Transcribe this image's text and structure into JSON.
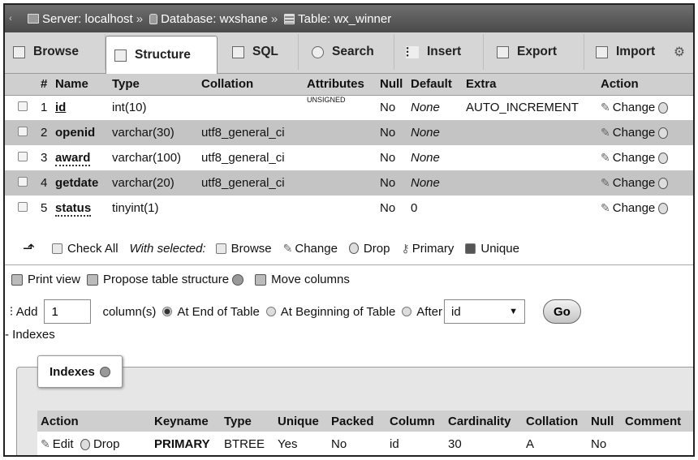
{
  "breadcrumb": {
    "server_label": "Server: localhost",
    "database_label": "Database: wxshane",
    "table_label": "Table: wx_winner",
    "separator": "»"
  },
  "tabs": [
    {
      "label": "Browse",
      "icon": "browse-icon"
    },
    {
      "label": "Structure",
      "icon": "structure-icon",
      "active": true
    },
    {
      "label": "SQL",
      "icon": "sql-icon"
    },
    {
      "label": "Search",
      "icon": "search-icon"
    },
    {
      "label": "Insert",
      "icon": "insert-icon"
    },
    {
      "label": "Export",
      "icon": "export-icon"
    },
    {
      "label": "Import",
      "icon": "import-icon"
    }
  ],
  "structure": {
    "headers": [
      "#",
      "Name",
      "Type",
      "Collation",
      "Attributes",
      "Null",
      "Default",
      "Extra",
      "Action"
    ],
    "rows": [
      {
        "num": "1",
        "name": "id",
        "type": "int(10)",
        "collation": "",
        "attributes": "UNSIGNED",
        "null": "No",
        "default": "None",
        "extra": "AUTO_INCREMENT",
        "action": "Change"
      },
      {
        "num": "2",
        "name": "openid",
        "type": "varchar(30)",
        "collation": "utf8_general_ci",
        "attributes": "",
        "null": "No",
        "default": "None",
        "extra": "",
        "action": "Change"
      },
      {
        "num": "3",
        "name": "award",
        "type": "varchar(100)",
        "collation": "utf8_general_ci",
        "attributes": "",
        "null": "No",
        "default": "None",
        "extra": "",
        "action": "Change"
      },
      {
        "num": "4",
        "name": "getdate",
        "type": "varchar(20)",
        "collation": "utf8_general_ci",
        "attributes": "",
        "null": "No",
        "default": "None",
        "extra": "",
        "action": "Change"
      },
      {
        "num": "5",
        "name": "status",
        "type": "tinyint(1)",
        "collation": "",
        "attributes": "",
        "null": "No",
        "default": "0",
        "extra": "",
        "action": "Change"
      }
    ]
  },
  "bulk": {
    "check_all": "Check All",
    "with_selected": "With selected:",
    "browse": "Browse",
    "change": "Change",
    "drop": "Drop",
    "primary": "Primary",
    "unique": "Unique"
  },
  "tools": {
    "print_view": "Print view",
    "propose": "Propose table structure",
    "move_columns": "Move columns"
  },
  "add_columns": {
    "add_label": "Add",
    "count_value": "1",
    "columns_label": "column(s)",
    "at_end": "At End of Table",
    "at_beginning": "At Beginning of Table",
    "after": "After",
    "after_value": "id",
    "go": "Go"
  },
  "indexes": {
    "toggle_label": "- Indexes",
    "legend": "Indexes",
    "headers": [
      "Action",
      "Keyname",
      "Type",
      "Unique",
      "Packed",
      "Column",
      "Cardinality",
      "Collation",
      "Null",
      "Comment"
    ],
    "row": {
      "edit": "Edit",
      "drop": "Drop",
      "keyname": "PRIMARY",
      "type": "BTREE",
      "unique": "Yes",
      "packed": "No",
      "column": "id",
      "cardinality": "30",
      "collation": "A",
      "null": "No",
      "comment": ""
    }
  }
}
